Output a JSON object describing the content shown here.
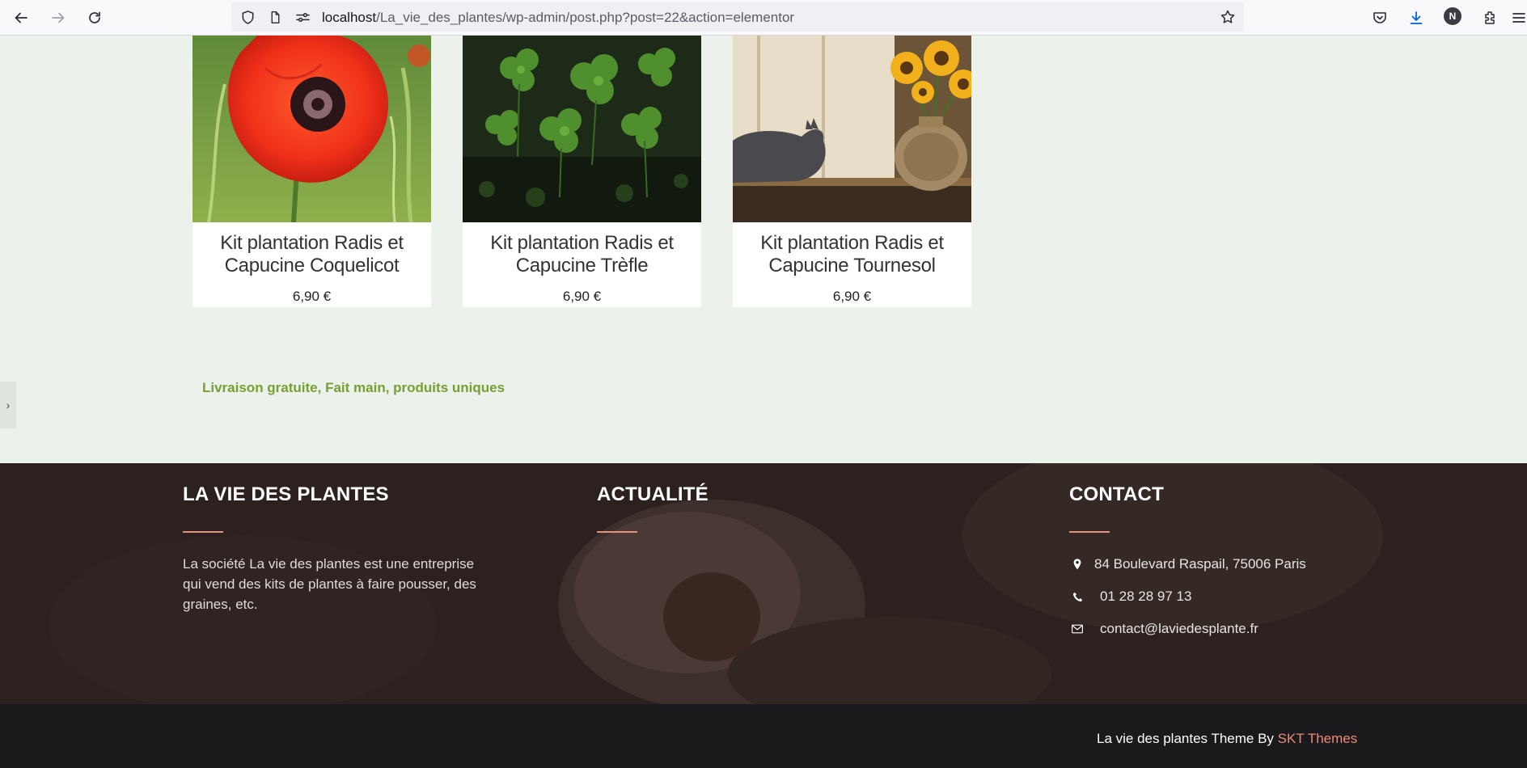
{
  "browser": {
    "url_host": "localhost",
    "url_path": "/La_vie_des_plantes/wp-admin/post.php?post=22&action=elementor",
    "profile_initial": "N",
    "icons": [
      "back-icon",
      "forward-icon",
      "reload-icon",
      "shield-icon",
      "page-icon",
      "permissions-icon",
      "bookmark-star-icon",
      "pocket-icon",
      "download-icon",
      "extensions-icon",
      "menu-icon"
    ]
  },
  "products": [
    {
      "name": "Kit plantation Radis et Capucine Coquelicot",
      "price": "6,90 €",
      "image": "poppy-photo"
    },
    {
      "name": "Kit plantation Radis et Capucine Trèfle",
      "price": "6,90 €",
      "image": "clover-photo"
    },
    {
      "name": "Kit plantation Radis et Capucine Tournesol",
      "price": "6,90 €",
      "image": "sunflower-cat-photo"
    }
  ],
  "tagline": "Livraison gratuite, Fait main, produits uniques",
  "side_toggle": "›",
  "footer": {
    "about_title": "LA VIE DES PLANTES",
    "about_text": "La société La vie des plantes est une entreprise qui vend des kits de plantes à faire pousser, des graines, etc.",
    "news_title": "ACTUALITÉ",
    "contact_title": "CONTACT",
    "address": "84 Boulevard Raspail, 75006 Paris",
    "phone": "01 28 28 97 13",
    "email": "contact@laviedesplante.fr",
    "credit_prefix": "La vie des plantes Theme By ",
    "credit_link": "SKT Themes"
  },
  "colors": {
    "accent_green": "#75a130",
    "accent_salmon": "#ef8a77",
    "footer_bg": "#2a1f1d",
    "page_bg": "#edf1ec"
  }
}
